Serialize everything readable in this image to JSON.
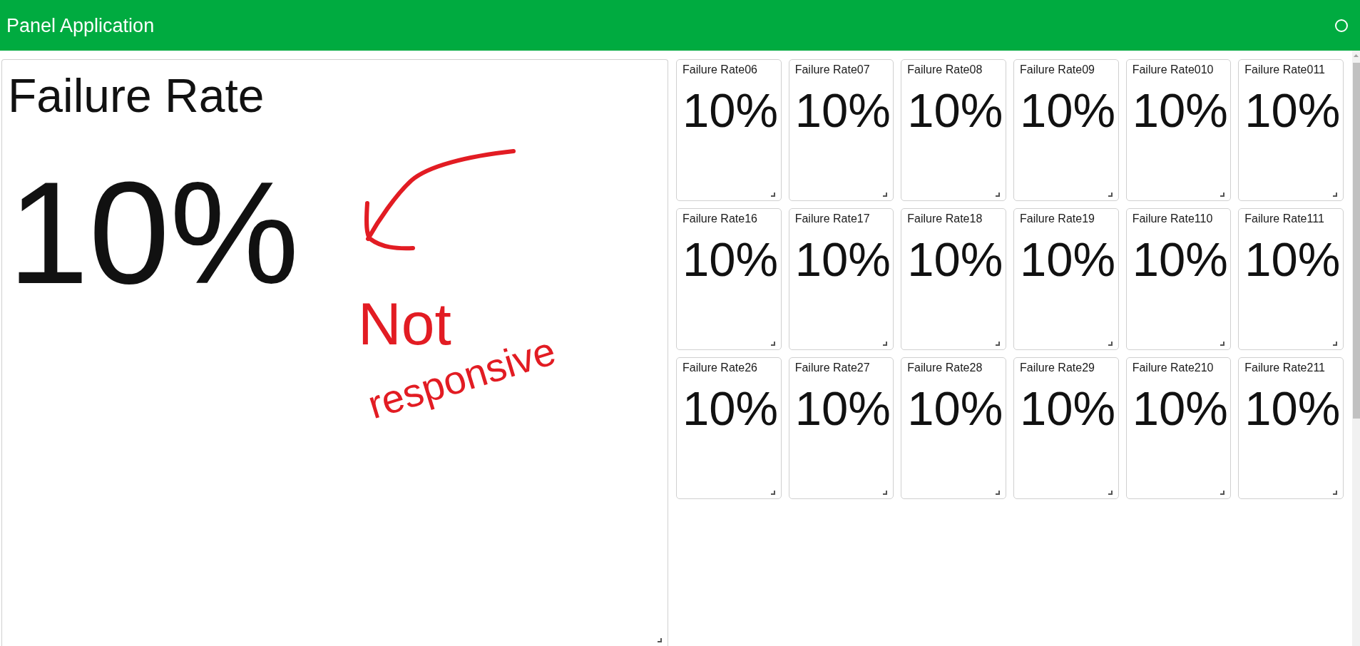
{
  "header": {
    "title": "Panel Application"
  },
  "main_panel": {
    "title": "Failure Rate",
    "value": "10%"
  },
  "annotation": {
    "lines": [
      "Not",
      "responsive"
    ]
  },
  "cards": [
    {
      "title": "Failure Rate06",
      "value": "10%"
    },
    {
      "title": "Failure Rate07",
      "value": "10%"
    },
    {
      "title": "Failure Rate08",
      "value": "10%"
    },
    {
      "title": "Failure Rate09",
      "value": "10%"
    },
    {
      "title": "Failure Rate010",
      "value": "10%"
    },
    {
      "title": "Failure Rate011",
      "value": "10%"
    },
    {
      "title": "Failure Rate16",
      "value": "10%"
    },
    {
      "title": "Failure Rate17",
      "value": "10%"
    },
    {
      "title": "Failure Rate18",
      "value": "10%"
    },
    {
      "title": "Failure Rate19",
      "value": "10%"
    },
    {
      "title": "Failure Rate110",
      "value": "10%"
    },
    {
      "title": "Failure Rate111",
      "value": "10%"
    },
    {
      "title": "Failure Rate26",
      "value": "10%"
    },
    {
      "title": "Failure Rate27",
      "value": "10%"
    },
    {
      "title": "Failure Rate28",
      "value": "10%"
    },
    {
      "title": "Failure Rate29",
      "value": "10%"
    },
    {
      "title": "Failure Rate210",
      "value": "10%"
    },
    {
      "title": "Failure Rate211",
      "value": "10%"
    }
  ]
}
